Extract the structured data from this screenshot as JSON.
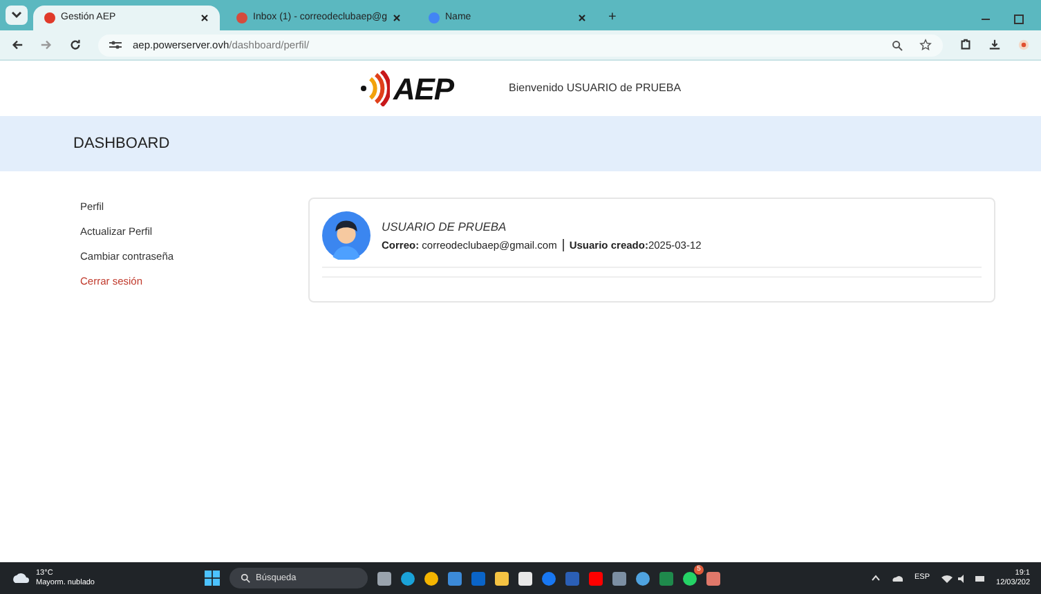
{
  "browser": {
    "tabs": [
      {
        "title": "Gestión AEP",
        "selected": true
      },
      {
        "title": "Inbox (1) - correodeclubaep@g",
        "selected": false
      },
      {
        "title": "Name",
        "selected": false
      }
    ],
    "new_tab": "+",
    "url_host": "aep.powerserver.ovh",
    "url_path": "/dashboard/perfil/"
  },
  "header": {
    "logo_text": "AEP",
    "welcome": "Bienvenido USUARIO de PRUEBA"
  },
  "banner": {
    "title": "DASHBOARD"
  },
  "sidebar": {
    "items": [
      {
        "label": "Perfil",
        "kind": "link"
      },
      {
        "label": "Actualizar Perfil",
        "kind": "link"
      },
      {
        "label": "Cambiar contraseña",
        "kind": "link"
      },
      {
        "label": "Cerrar sesión",
        "kind": "danger"
      }
    ]
  },
  "profile": {
    "name": "USUARIO DE PRUEBA",
    "email_label": "Correo:",
    "email": "correodeclubaep@gmail.com",
    "created_label": "Usuario creado:",
    "created": "2025-03-12"
  },
  "taskbar": {
    "temperature": "13°C",
    "weather": "Mayorm. nublado",
    "search_placeholder": "Búsqueda",
    "whatsapp_badge": "5",
    "language": "ESP",
    "time": "19:1",
    "date": "12/03/202"
  }
}
